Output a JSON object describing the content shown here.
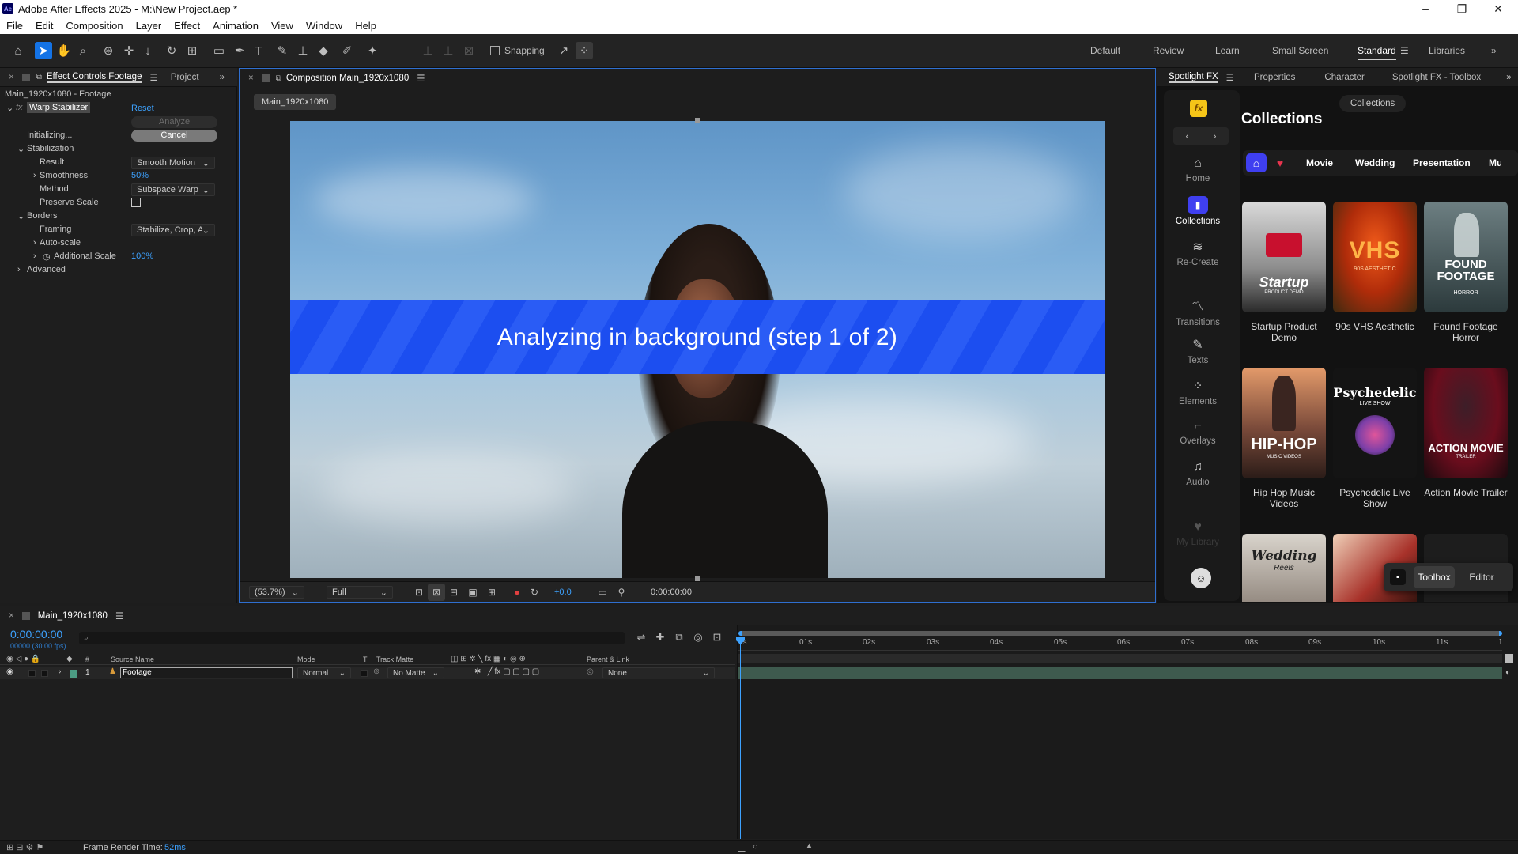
{
  "window": {
    "title": "Adobe After Effects 2025 - M:\\New Project.aep *",
    "logo": "Ae"
  },
  "menu": [
    "File",
    "Edit",
    "Composition",
    "Layer",
    "Effect",
    "Animation",
    "View",
    "Window",
    "Help"
  ],
  "toolbar": {
    "snapping_label": "Snapping",
    "workspaces": [
      "Default",
      "Review",
      "Learn",
      "Small Screen",
      "Standard",
      "Libraries"
    ],
    "active_workspace": "Standard"
  },
  "effect_controls": {
    "tab_label": "Effect Controls Footage",
    "project_tab": "Project",
    "layer_path": "Main_1920x1080 - Footage",
    "effect_name": "Warp Stabilizer",
    "reset": "Reset",
    "analyze": "Analyze",
    "status": "Initializing...",
    "cancel": "Cancel",
    "stabilization": "Stabilization",
    "result_label": "Result",
    "result_value": "Smooth Motion",
    "smoothness_label": "Smoothness",
    "smoothness_value": "50%",
    "method_label": "Method",
    "method_value": "Subspace Warp",
    "preserve_scale": "Preserve Scale",
    "borders": "Borders",
    "framing_label": "Framing",
    "framing_value": "Stabilize, Crop, Auto-scale",
    "autoscale": "Auto-scale",
    "additional_scale_label": "Additional Scale",
    "additional_scale_value": "100%",
    "advanced": "Advanced"
  },
  "composition": {
    "tab_label": "Composition Main_1920x1080",
    "chip": "Main_1920x1080",
    "banner": "Analyzing in background (step 1 of 2)",
    "zoom": "(53.7%)",
    "resolution": "Full",
    "exposure": "+0.0",
    "timecode": "0:00:00:00"
  },
  "spotlight": {
    "tabs": [
      "Spotlight FX",
      "Properties",
      "Character",
      "Spotlight FX - Toolbox"
    ],
    "collections_button": "Collections",
    "heading": "Collections",
    "filters": [
      "Movie",
      "Wedding",
      "Presentation",
      "Mu"
    ],
    "nav": [
      "Home",
      "Collections",
      "Re-Create",
      "Transitions",
      "Texts",
      "Elements",
      "Overlays",
      "Audio",
      "My Library"
    ],
    "cards": [
      {
        "title": "Startup Product Demo",
        "thumb": "Startup",
        "thumb_sub": "PRODUCT DEMO"
      },
      {
        "title": "90s VHS Aesthetic",
        "thumb": "VHS",
        "thumb_sub": "90S AESTHETIC"
      },
      {
        "title": "Found Footage Horror",
        "thumb": "FOUND FOOTAGE",
        "thumb_sub": "HORROR"
      },
      {
        "title": "Hip Hop Music Videos",
        "thumb": "HIP-HOP",
        "thumb_sub": "MUSIC VIDEOS"
      },
      {
        "title": "Psychedelic Live Show",
        "thumb": "Psychedelic",
        "thumb_sub": "LIVE SHOW"
      },
      {
        "title": "Action Movie Trailer",
        "thumb": "ACTION MOVIE",
        "thumb_sub": "TRAILER"
      },
      {
        "title": "",
        "thumb": "Wedding",
        "thumb_sub": "Reels"
      }
    ],
    "toolbox": "Toolbox",
    "editor": "Editor"
  },
  "timeline": {
    "tab_label": "Main_1920x1080",
    "timecode": "0:00:00:00",
    "frames": "00000 (30.00 fps)",
    "headers": {
      "source": "Source Name",
      "mode": "Mode",
      "t": "T",
      "track_matte": "Track Matte",
      "parent": "Parent & Link",
      "num": "#"
    },
    "layer": {
      "num": "1",
      "name": "Footage",
      "mode": "Normal",
      "matte": "No Matte",
      "parent": "None"
    },
    "ruler": [
      "0s",
      "01s",
      "02s",
      "03s",
      "04s",
      "05s",
      "06s",
      "07s",
      "08s",
      "09s",
      "10s",
      "11s",
      "1"
    ]
  },
  "statusbar": {
    "label": "Frame Render Time:",
    "value": "52ms"
  },
  "colors": {
    "accent": "#1473e6",
    "banner": "#1c4ef0",
    "spotlight_yellow": "#f5c518",
    "track": "#3e5a4e"
  }
}
